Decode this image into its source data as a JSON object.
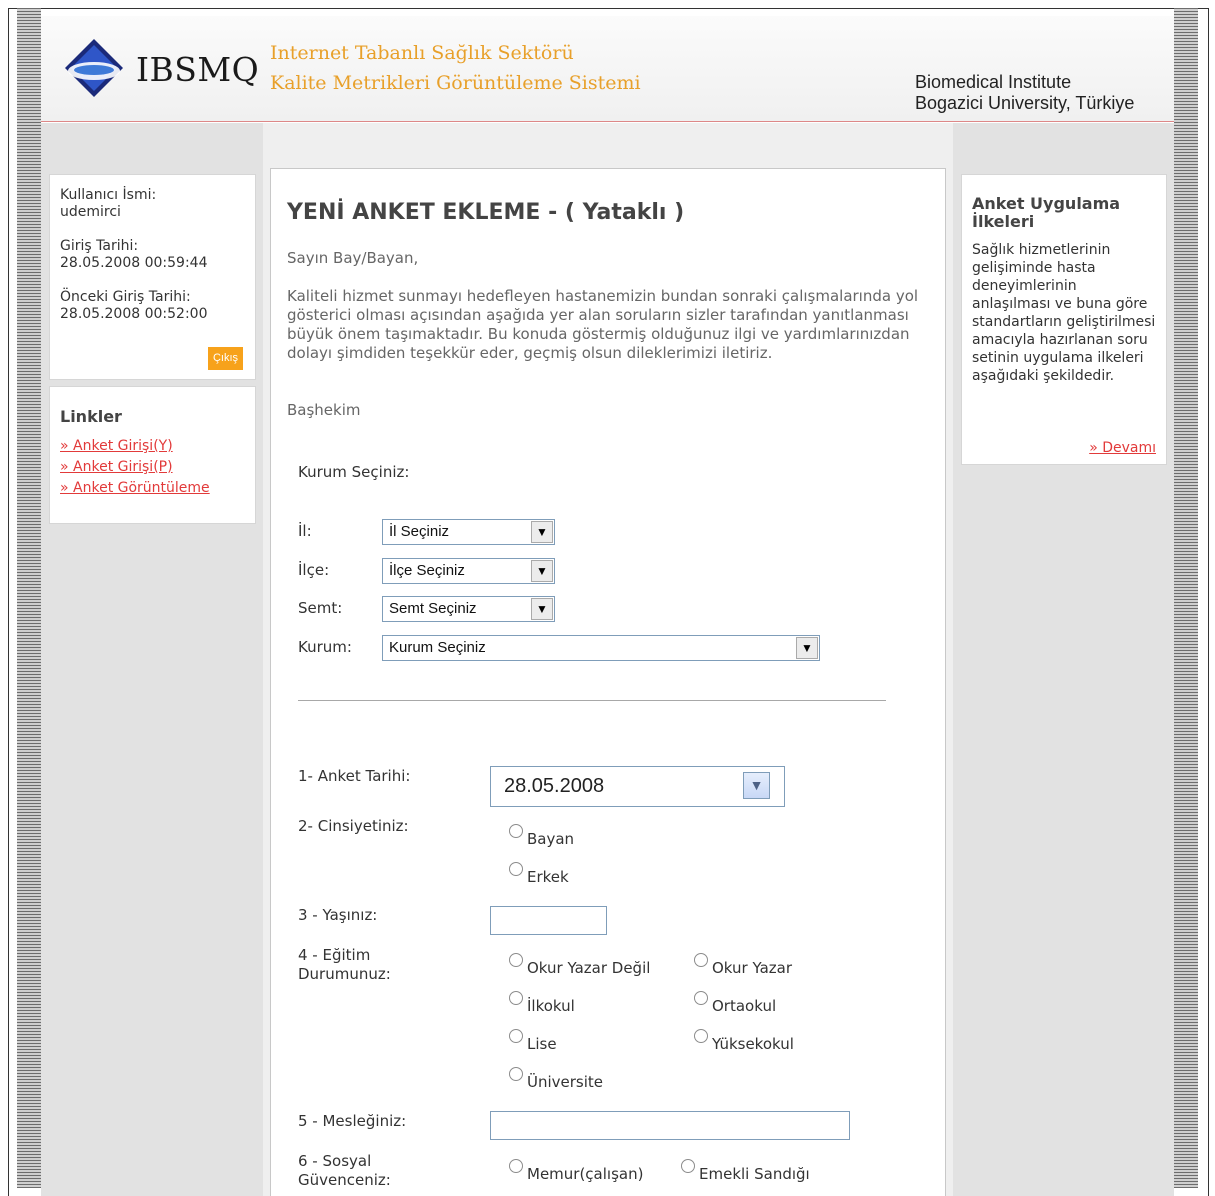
{
  "header": {
    "logo_text": "IBSMQ",
    "title_line1": "Internet Tabanlı Sağlık Sektörü",
    "title_line2": "Kalite Metrikleri Görüntüleme Sistemi",
    "institute_line1": "Biomedical Institute",
    "institute_line2": "Bogazici University, Türkiye"
  },
  "user": {
    "username_label": "Kullanıcı İsmi:",
    "username": "udemirci",
    "login_date_label": "Giriş Tarihi:",
    "login_date": "28.05.2008 00:59:44",
    "prev_login_label": "Önceki Giriş Tarihi:",
    "prev_login_date": "28.05.2008 00:52:00",
    "logout_label": "Çıkış"
  },
  "links": {
    "title": "Linkler",
    "items": [
      "» Anket Girişi(Y)",
      "» Anket Girişi(P)",
      "» Anket Görüntüleme"
    ]
  },
  "rules": {
    "title": "Anket Uygulama İlkeleri",
    "text": "Sağlık hizmetlerinin gelişiminde hasta deneyimlerinin anlaşılması ve buna göre standartların geliştirilmesi amacıyla hazırlanan soru setinin uygulama ilkeleri aşağıdaki şekildedir.",
    "more": "» Devamı"
  },
  "main": {
    "title": "YENİ ANKET EKLEME - ( Yataklı )",
    "greeting": "Sayın Bay/Bayan,",
    "intro": "Kaliteli hizmet sunmayı hedefleyen hastanemizin bundan sonraki çalışmalarında yol gösterici olması açısından aşağıda yer alan soruların sizler tarafından yanıtlanması büyük önem taşımaktadır. Bu konuda göstermiş olduğunuz ilgi ve yardımlarınızdan dolayı şimdiden teşekkür eder, geçmiş olsun dileklerimizi iletiriz.",
    "signature": "Başhekim",
    "institution_prompt": "Kurum Seçiniz:",
    "il_label": "İl:",
    "il_value": "İl Seçiniz",
    "ilce_label": "İlçe:",
    "ilce_value": "İlçe Seçiniz",
    "semt_label": "Semt:",
    "semt_value": "Semt Seçiniz",
    "kurum_label": "Kurum:",
    "kurum_value": "Kurum Seçiniz"
  },
  "questions": {
    "q1_label": "1- Anket Tarihi:",
    "q1_value": "28.05.2008",
    "q2_label": "2- Cinsiyetiniz:",
    "q2_options": [
      "Bayan",
      "Erkek"
    ],
    "q3_label": "3 - Yaşınız:",
    "q4_label_line1": "4 - Eğitim",
    "q4_label_line2": "Durumunuz:",
    "q4_options": [
      "Okur Yazar Değil",
      "Okur Yazar",
      "İlkokul",
      "Ortaokul",
      "Lise",
      "Yüksekokul",
      "Üniversite"
    ],
    "q5_label": "5 - Mesleğiniz:",
    "q6_label_line1": "6 - Sosyal",
    "q6_label_line2": "Güvenceniz:",
    "q6_options": [
      "Memur(çalışan)",
      "Emekli Sandığı"
    ]
  }
}
